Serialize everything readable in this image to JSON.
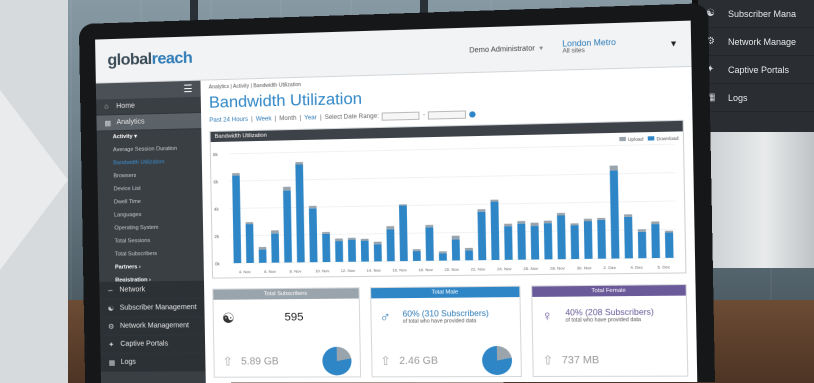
{
  "app": {
    "logo_main": "global",
    "logo_accent": "reach",
    "user_label": "Demo Administrator",
    "region_title": "London Metro",
    "region_sub": "All sites"
  },
  "sidebar": {
    "items_top": [
      {
        "label": "Home",
        "icon": "home-icon"
      },
      {
        "label": "Analytics",
        "icon": "analytics-icon"
      }
    ],
    "activity_head": "Activity ▾",
    "activity_items": [
      "Average Session Duration",
      "Bandwidth Utilization",
      "Browsers",
      "Device List",
      "Dwell Time",
      "Languages",
      "Operating System",
      "Total Sessions",
      "Total Subscribers"
    ],
    "partners": "Partners ›",
    "registration": "Registration ›",
    "items_bottom": [
      {
        "label": "Network",
        "icon": "chart-icon"
      },
      {
        "label": "Subscriber Management",
        "icon": "users-icon"
      },
      {
        "label": "Network Management",
        "icon": "gear-icon"
      },
      {
        "label": "Captive Portals",
        "icon": "portal-icon"
      },
      {
        "label": "Logs",
        "icon": "file-icon"
      }
    ]
  },
  "content": {
    "breadcrumb": "Analytics | Activity | Bandwidth Utilization",
    "title": "Bandwidth Utilization",
    "range": {
      "past": "Past 24 Hours",
      "week": "Week",
      "month": "Month",
      "year": "Year",
      "select": "Select Date Range:"
    },
    "chart_head": "Bandwidth Utilization",
    "legend_upload": "Upload",
    "legend_download": "Download"
  },
  "chart_data": {
    "type": "bar",
    "title": "Bandwidth Utilization",
    "y_ticks": [
      "8k",
      "6k",
      "4k",
      "2k",
      "0k"
    ],
    "x_ticks": [
      "4. Nov",
      "6. Nov",
      "8. Nov",
      "10. Nov",
      "12. Nov",
      "14. Nov",
      "16. Nov",
      "18. Nov",
      "20. Nov",
      "22. Nov",
      "24. Nov",
      "26. Nov",
      "28. Nov",
      "30. Nov",
      "2. Dec",
      "4. Dec",
      "6. Dec"
    ],
    "ylim": [
      0,
      9000
    ],
    "series": [
      {
        "name": "Upload",
        "color": "#9aa4ac",
        "values": [
          200,
          150,
          200,
          250,
          300,
          200,
          200,
          150,
          200,
          150,
          150,
          200,
          250,
          100,
          150,
          200,
          150,
          300,
          200,
          200,
          150,
          200,
          200,
          250,
          200,
          200,
          150,
          200,
          150,
          400,
          200,
          200,
          200,
          150
        ]
      },
      {
        "name": "Download",
        "color": "#2e86c6",
        "values": [
          7200,
          3200,
          1100,
          2400,
          5900,
          8000,
          4400,
          2300,
          1700,
          1800,
          1700,
          1400,
          2600,
          4500,
          800,
          2700,
          600,
          1700,
          800,
          3900,
          4700,
          2700,
          2900,
          2700,
          2900,
          3500,
          2700,
          3000,
          3100,
          7000,
          3300,
          2100,
          2700,
          2000
        ]
      }
    ],
    "grid": true,
    "legend": "top-right"
  },
  "cards": [
    {
      "head": "Total Subscribers",
      "head_color": "#9aa4ac",
      "value": "595",
      "storage": "5.89 GB",
      "icon": "users-icon"
    },
    {
      "head": "Total Male",
      "head_color": "#2e86c6",
      "value": "60% (310 Subscribers)",
      "note": "of total who have provided data",
      "storage": "2.46 GB",
      "icon": "male-icon"
    },
    {
      "head": "Total Female",
      "head_color": "#6a5a9a",
      "value": "40% (208 Subscribers)",
      "note": "of total who have provided data",
      "storage": "737 MB",
      "icon": "female-icon"
    }
  ],
  "monitor": {
    "items": [
      {
        "label": "Subscriber Mana",
        "icon": "users-icon"
      },
      {
        "label": "Network Manage",
        "icon": "gear-icon"
      },
      {
        "label": "Captive Portals",
        "icon": "portal-icon"
      },
      {
        "label": "Logs",
        "icon": "file-icon"
      }
    ]
  }
}
